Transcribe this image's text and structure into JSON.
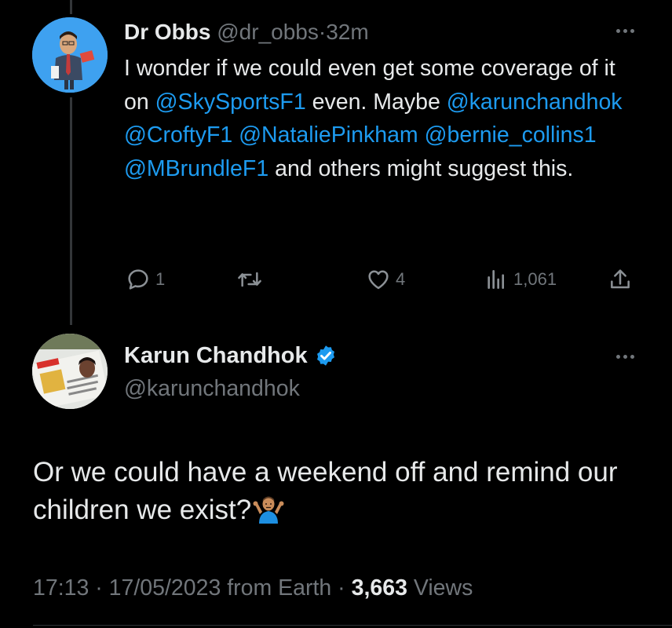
{
  "reply": {
    "name": "Dr Obbs",
    "handle": "@dr_obbs",
    "separator": "·",
    "time": "32m",
    "text_segments": [
      {
        "text": "I wonder if we could even get some coverage of it on ",
        "mention": false
      },
      {
        "text": "@SkySportsF1",
        "mention": true
      },
      {
        "text": " even. Maybe ",
        "mention": false
      },
      {
        "text": "@karunchandhok",
        "mention": true
      },
      {
        "text": " ",
        "mention": false
      },
      {
        "text": "@CroftyF1",
        "mention": true
      },
      {
        "text": " ",
        "mention": false
      },
      {
        "text": "@NataliePinkham",
        "mention": true
      },
      {
        "text": " ",
        "mention": false
      },
      {
        "text": "@bernie_collins1",
        "mention": true
      },
      {
        "text": " ",
        "mention": false
      },
      {
        "text": "@MBrundleF1",
        "mention": true
      },
      {
        "text": " and others might suggest this.",
        "mention": false
      }
    ],
    "actions": {
      "reply_count": "1",
      "retweet_count": "",
      "like_count": "4",
      "views_count": "1,061"
    }
  },
  "tweet": {
    "name": "Karun Chandhok",
    "verified": true,
    "handle": "@karunchandhok",
    "text": "Or we could have a weekend off and remind our children we exist?",
    "emoji": "person-shrugging-emoji",
    "time": "17:13",
    "date": "17/05/2023",
    "source": "from Earth",
    "separator": "·",
    "views_count": "3,663",
    "views_label": "Views"
  },
  "icons": [
    "more-icon",
    "reply-icon",
    "retweet-icon",
    "like-icon",
    "views-icon",
    "share-icon",
    "verified-badge-icon"
  ],
  "colors": {
    "background": "#000000",
    "text": "#e7e9ea",
    "muted": "#71767b",
    "mention": "#1d9bf0",
    "verified": "#1d9bf0"
  }
}
